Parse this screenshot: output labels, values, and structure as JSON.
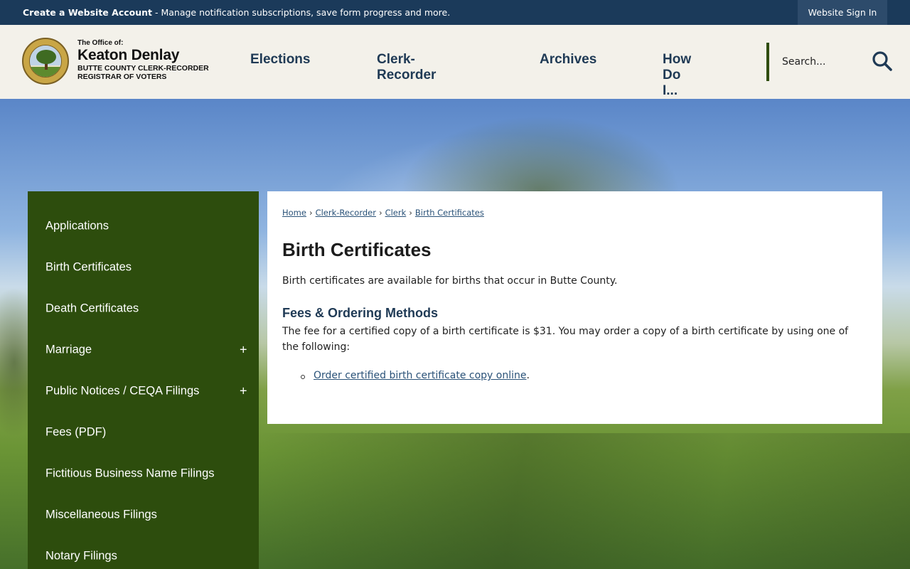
{
  "topbar": {
    "account_strong": "Create a Website Account",
    "account_rest": " - Manage notification subscriptions, save form progress and more.",
    "signin": "Website Sign In"
  },
  "logo": {
    "line1": "The Office of:",
    "line2": "Keaton Denlay",
    "line3": "BUTTE COUNTY CLERK-RECORDER",
    "line4": "REGISTRAR OF VOTERS"
  },
  "nav": {
    "items": [
      "Elections",
      "Clerk-Recorder",
      "Archives",
      "How Do I..."
    ]
  },
  "search": {
    "placeholder": "Search..."
  },
  "sidebar": {
    "items": [
      {
        "label": "Applications",
        "expand": ""
      },
      {
        "label": "Birth Certificates",
        "expand": ""
      },
      {
        "label": "Death Certificates",
        "expand": ""
      },
      {
        "label": "Marriage",
        "expand": "+"
      },
      {
        "label": "Public Notices / CEQA Filings",
        "expand": "+"
      },
      {
        "label": "Fees (PDF)",
        "expand": ""
      },
      {
        "label": "Fictitious Business Name Filings",
        "expand": ""
      },
      {
        "label": "Miscellaneous Filings",
        "expand": ""
      },
      {
        "label": "Notary Filings",
        "expand": ""
      }
    ]
  },
  "content": {
    "breadcrumb": [
      "Home",
      "Clerk-Recorder",
      "Clerk",
      "Birth Certificates"
    ],
    "breadcrumb_sep": "›",
    "title": "Birth Certificates",
    "intro": "Birth certificates are available for births that occur in Butte County.",
    "fees_heading": "Fees & Ordering Methods",
    "fees_text": "The fee for a certified copy of a birth certificate is $31. You may order a copy of a birth certificate by using one of the following:",
    "link": "Order certified birth certificate copy online",
    "link_suffix": "."
  },
  "colors": {
    "topbar": "#1b3a5a",
    "sidebar": "#2d4d0d",
    "nav_text": "#1f3a55",
    "link": "#2a5278"
  }
}
